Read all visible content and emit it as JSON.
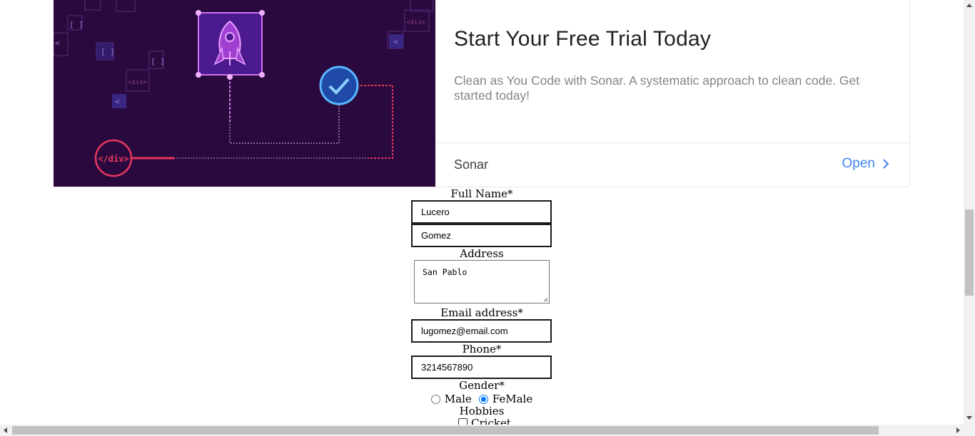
{
  "ad": {
    "title": "Start Your Free Trial Today",
    "description": "Clean as You Code with Sonar. A systematic approach to clean code. Get started today!",
    "brand": "Sonar",
    "cta": "Open",
    "art_tag_left": "</div>",
    "art_tag_small": "<div>",
    "colors": {
      "art_bg": "#2a0a3e",
      "cta": "#4285f4",
      "accent_pink": "#e8365e",
      "accent_blue": "#4aa3ff",
      "accent_purple": "#b44fe0"
    }
  },
  "form": {
    "full_name_label": "Full Name*",
    "first_name_value": "Lucero",
    "last_name_value": "Gomez",
    "address_label": "Address",
    "address_value": "San Pablo",
    "email_label": "Email address*",
    "email_value": "lugomez@email.com",
    "phone_label": "Phone*",
    "phone_value": "3214567890",
    "gender_label": "Gender*",
    "gender_options": [
      "Male",
      "FeMale"
    ],
    "gender_selected": "FeMale",
    "hobbies_label": "Hobbies",
    "hobby_first": "Cricket"
  }
}
